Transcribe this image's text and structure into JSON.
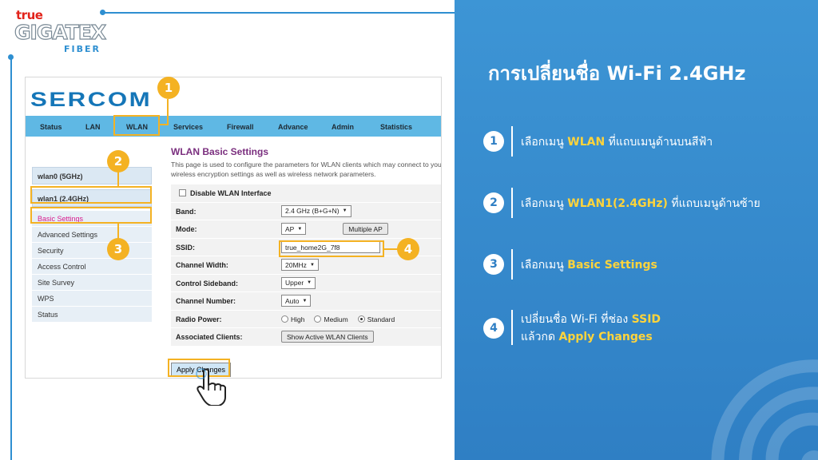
{
  "brand": {
    "true": "true",
    "gigatex": "GIGATEX",
    "fiber": "FIBER"
  },
  "router": {
    "logo": "SERCOM",
    "nav": [
      "Status",
      "LAN",
      "WLAN",
      "Services",
      "Firewall",
      "Advance",
      "Admin",
      "Statistics"
    ],
    "sidebar": {
      "wlan0": "wlan0 (5GHz)",
      "wlan1": "wlan1 (2.4GHz)",
      "items": [
        "Basic Settings",
        "Advanced Settings",
        "Security",
        "Access Control",
        "Site Survey",
        "WPS",
        "Status"
      ]
    },
    "content": {
      "title": "WLAN Basic Settings",
      "desc_line1": "This page is used to configure the parameters for WLAN clients which may connect to you",
      "desc_line2": "wireless encryption settings as well as wireless network parameters."
    },
    "form": {
      "disable_label": "Disable WLAN Interface",
      "band_label": "Band:",
      "band_value": "2.4 GHz (B+G+N)",
      "mode_label": "Mode:",
      "mode_value": "AP",
      "multiple_ap": "Multiple AP",
      "ssid_label": "SSID:",
      "ssid_value": "true_home2G_7f8",
      "width_label": "Channel Width:",
      "width_value": "20MHz",
      "sideband_label": "Control Sideband:",
      "sideband_value": "Upper",
      "channel_label": "Channel Number:",
      "channel_value": "Auto",
      "power_label": "Radio Power:",
      "power_high": "High",
      "power_medium": "Medium",
      "power_standard": "Standard",
      "clients_label": "Associated Clients:",
      "clients_button": "Show Active WLAN Clients"
    },
    "apply": "Apply Changes"
  },
  "callouts": [
    "1",
    "2",
    "3",
    "4"
  ],
  "panel": {
    "title": "การเปลี่ยนชื่อ  Wi-Fi  2.4GHz",
    "steps": [
      {
        "num": "1",
        "pre": "เลือกเมนู ",
        "hi": "WLAN",
        "post": " ที่แถบเมนูด้านบนสีฟ้า"
      },
      {
        "num": "2",
        "pre": "เลือกเมนู ",
        "hi": "WLAN1(2.4GHz)",
        "post": " ที่แถบเมนูด้านซ้าย"
      },
      {
        "num": "3",
        "pre": "เลือกเมนู ",
        "hi": "Basic  Settings",
        "post": ""
      },
      {
        "num": "4",
        "pre": "เปลี่ยนชื่อ  Wi-Fi  ที่ช่อง ",
        "hi": "SSID",
        "post": "",
        "line2_pre": "แล้วกด ",
        "line2_hi": "Apply  Changes"
      }
    ]
  },
  "colors": {
    "accent": "#f4b223",
    "panel": "#3d95d5",
    "highlight_text": "#ffd43b",
    "nav_bar": "#5fb8e4",
    "active_menu": "#d81b8d"
  }
}
